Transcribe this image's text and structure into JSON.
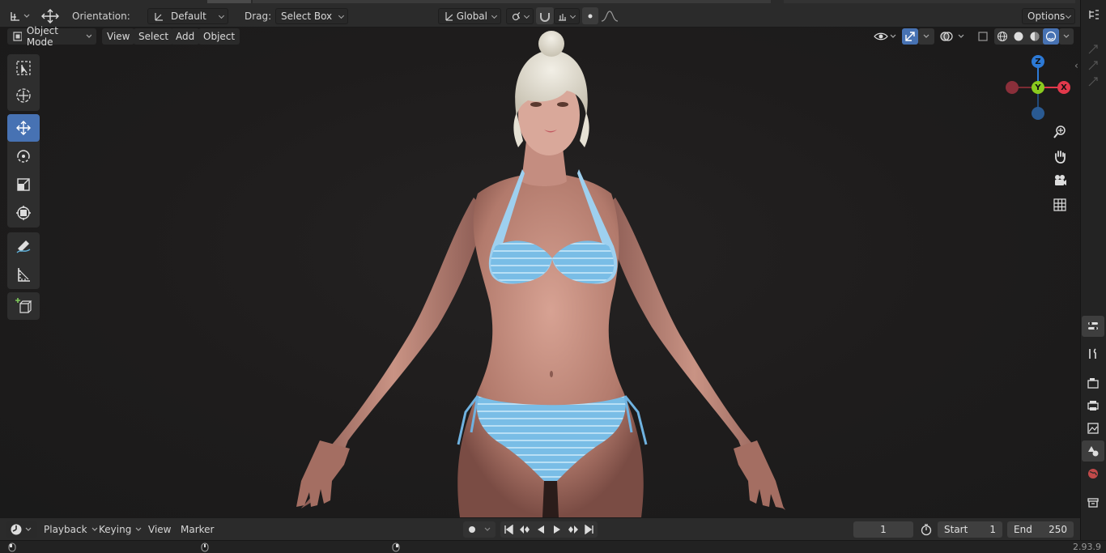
{
  "header": {
    "orientation_label": "Orientation:",
    "orientation_value": "Default",
    "drag_label": "Drag:",
    "drag_value": "Select Box",
    "transform_orientation": "Global",
    "options_label": "Options"
  },
  "viewport_header": {
    "mode": "Object Mode",
    "menus": [
      "View",
      "Select",
      "Add",
      "Object"
    ]
  },
  "timeline": {
    "menus": [
      "Playback",
      "Keying",
      "View",
      "Marker"
    ],
    "current_frame": "1",
    "start_label": "Start",
    "start_value": "1",
    "end_label": "End",
    "end_value": "250"
  },
  "gizmo": {
    "x": "X",
    "y": "Y",
    "z": "Z"
  },
  "status": {
    "version": "2.93.9"
  },
  "colors": {
    "active_tool": "#4772b3",
    "axis_x": "#e2394b",
    "axis_y": "#8acb1f",
    "axis_z": "#2d7ad6",
    "bikini": "#7fc3ea"
  }
}
